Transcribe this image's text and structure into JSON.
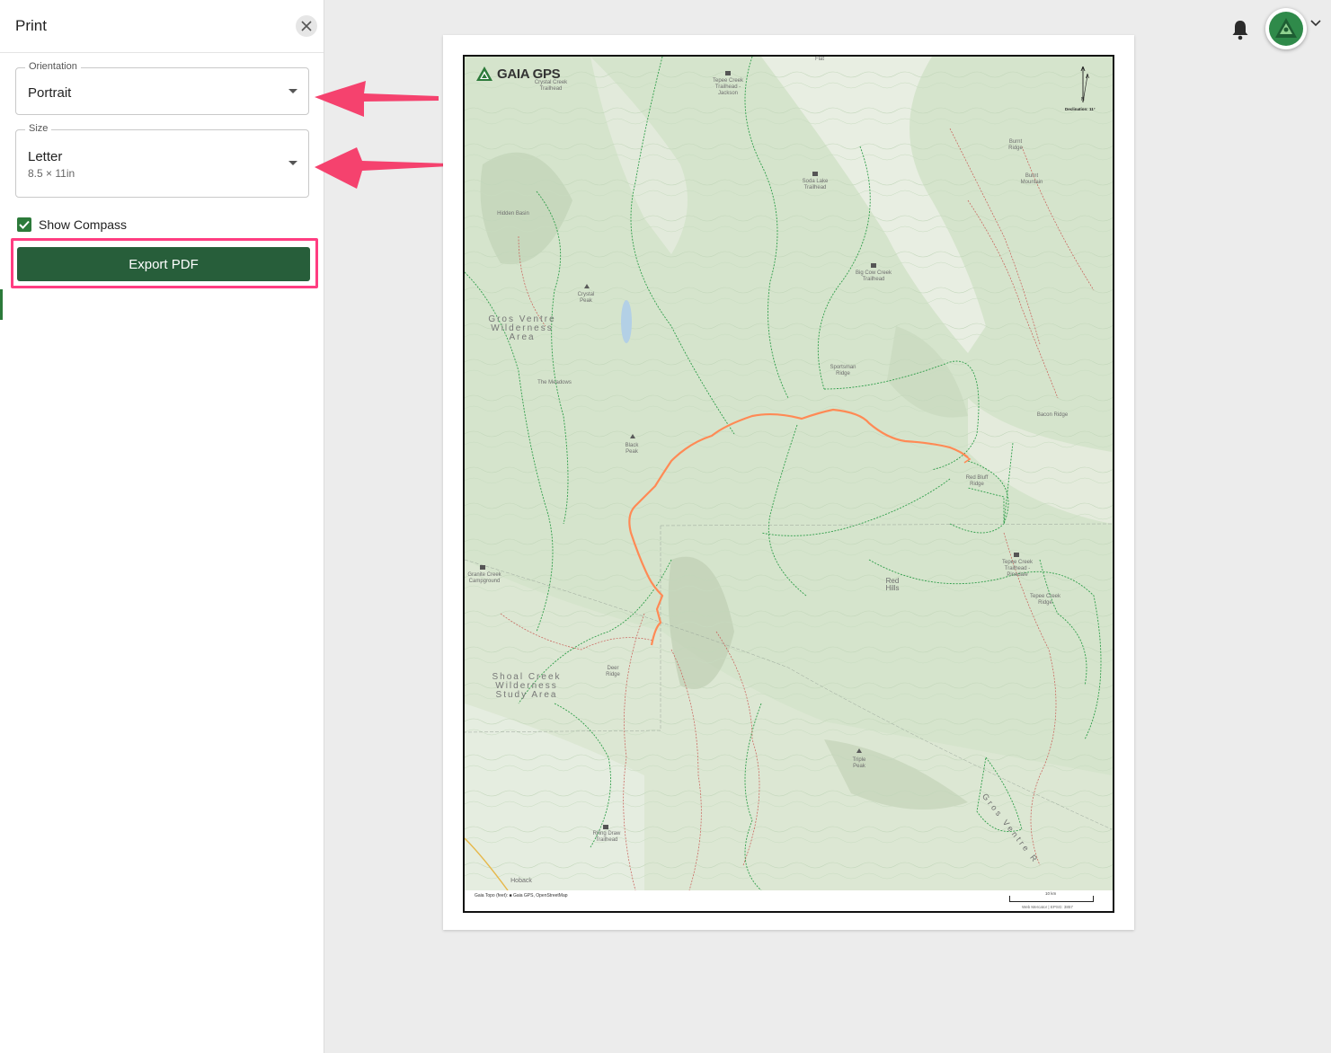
{
  "sidebar": {
    "title": "Print",
    "orientation": {
      "legend": "Orientation",
      "value": "Portrait"
    },
    "size": {
      "legend": "Size",
      "value": "Letter",
      "sub": "8.5 × 11in"
    },
    "show_compass": {
      "label": "Show Compass",
      "checked": true
    },
    "export_label": "Export PDF"
  },
  "colors": {
    "accent_green": "#275e3a",
    "highlight_pink": "#ff3d81",
    "route_orange": "#ff8a55"
  },
  "map": {
    "logo": "GAIA GPS",
    "declination": "Declination: 11°",
    "compass_n": "N",
    "footer": "Gaia Topo (feet): ■ Gaia GPS, OpenStreetMap",
    "scale_label": "10 km",
    "projection": "Web Mercator | EPSG: 3857",
    "labels": {
      "hidden_basin": "Hidden Basin",
      "gros_ventre_wa": "Gros Ventre Wilderness Area",
      "crystal": "Crystal Creek Trailhead",
      "tepee_jackson": "Tepee Creek Trailhead - Jackson",
      "soda_lake": "Soda Lake Trailhead",
      "big_cow": "Big Cow Creek Trailhead",
      "burnt_ridge": "Burnt Ridge",
      "burnt_mountain": "Burnt Mountain",
      "flat": "Flat",
      "crystal_peak": "Crystal Peak",
      "the_meadows": "The Meadows",
      "sportsman": "Sportsman Ridge",
      "black_peak": "Black Peak",
      "bacon_ridge": "Bacon Ridge",
      "red_bluff": "Red Bluff Ridge",
      "granite_creek": "Granite Creek Campground",
      "tepee_pinedale": "Tepee Creek Trailhead - Pinedale",
      "red_hills": "Red Hills",
      "tepee_ridge": "Tepee Creek Ridge",
      "deer_ridge": "Deer Ridge",
      "shoal_creek": "Shoal Creek Wilderness Study Area",
      "triple_peak": "Triple Peak",
      "riling_draw": "Riling Draw Trailhead",
      "hoback": "Hoback",
      "gros_ventre_range": "Gros Ventre R"
    }
  }
}
